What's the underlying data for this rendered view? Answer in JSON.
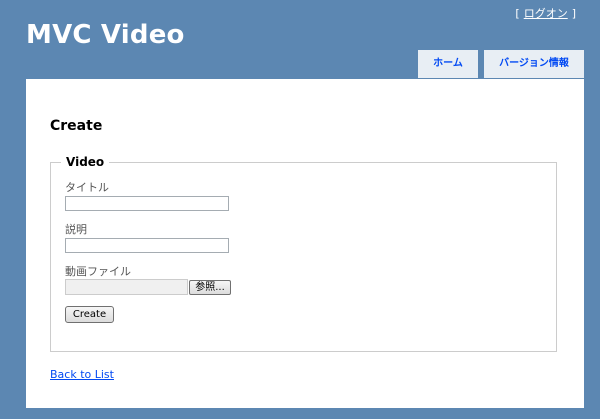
{
  "header": {
    "site_title": "MVC Video",
    "login": {
      "bracket_open": "[",
      "link_label": "ログオン",
      "bracket_close": "]"
    },
    "menu": [
      {
        "label": "ホーム"
      },
      {
        "label": "バージョン情報"
      }
    ]
  },
  "main": {
    "page_title": "Create",
    "form": {
      "legend": "Video",
      "fields": {
        "title": {
          "label": "タイトル",
          "value": ""
        },
        "description": {
          "label": "説明",
          "value": ""
        },
        "file": {
          "label": "動画ファイル",
          "value": "",
          "browse_label": "参照..."
        }
      },
      "submit_label": "Create"
    },
    "back_link": "Back to List"
  },
  "colors": {
    "page_background": "#5c87b2",
    "content_background": "#ffffff",
    "menu_background": "#e8eef4",
    "link": "#034af3"
  }
}
